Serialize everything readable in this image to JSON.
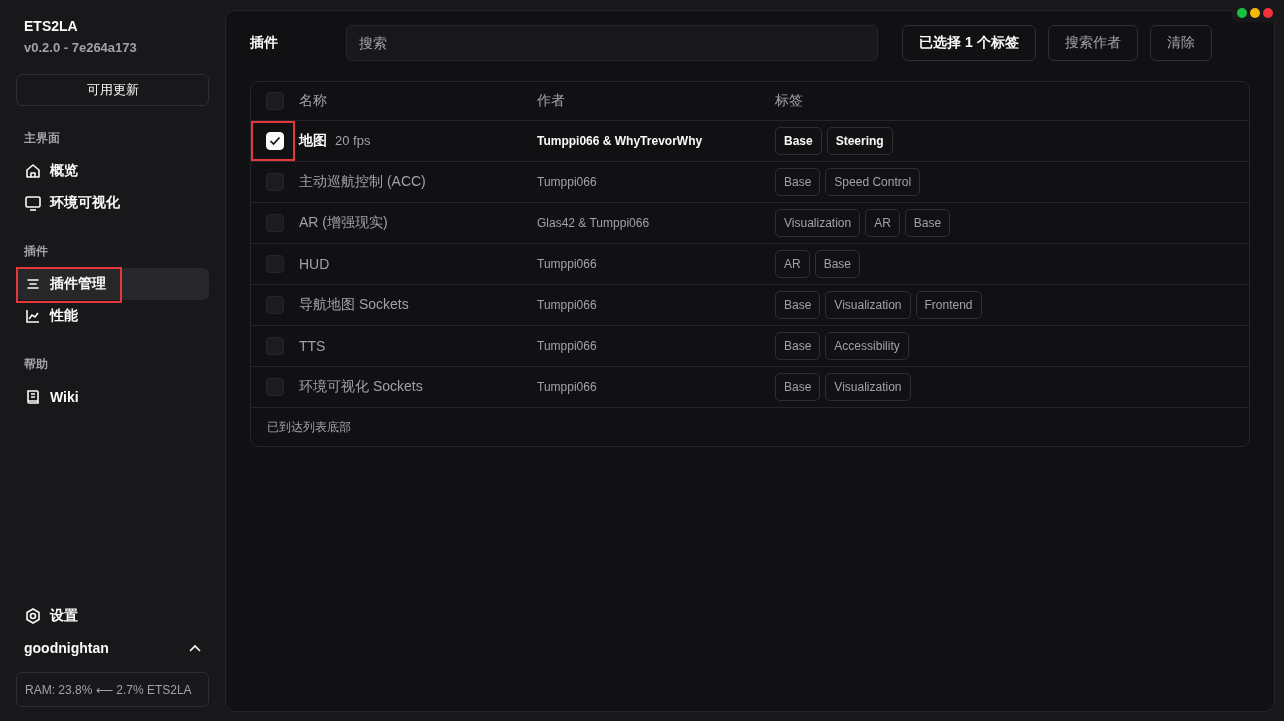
{
  "app": {
    "name": "ETS2LA",
    "version": "v0.2.0 - 7e264a173",
    "update_button": "可用更新"
  },
  "sidebar": {
    "sections": [
      {
        "title": "主界面",
        "items": [
          {
            "label": "概览",
            "selected": false,
            "highlighted": false
          },
          {
            "label": "环境可视化",
            "selected": false,
            "highlighted": false
          }
        ]
      },
      {
        "title": "插件",
        "items": [
          {
            "label": "插件管理",
            "selected": true,
            "highlighted": true
          },
          {
            "label": "性能",
            "selected": false,
            "highlighted": false
          }
        ]
      },
      {
        "title": "帮助",
        "items": [
          {
            "label": "Wiki",
            "selected": false,
            "highlighted": false
          }
        ]
      }
    ],
    "settings": "设置",
    "user": "goodnightan",
    "status": "RAM: 23.8% ⟵ 2.7% ETS2LA"
  },
  "header": {
    "title": "插件",
    "search": {
      "placeholder": "搜索"
    },
    "buttons": [
      {
        "label": "已选择 1 个标签",
        "active": true
      },
      {
        "label": "搜索作者",
        "active": false
      },
      {
        "label": "清除",
        "active": false
      }
    ]
  },
  "table": {
    "columns": [
      "名称",
      "作者",
      "标签"
    ],
    "all_checked": false,
    "rows": [
      {
        "name": "地图",
        "fps": "20 fps",
        "author": "Tumppi066 & WhyTrevorWhy",
        "tags": [
          "Base",
          "Steering"
        ],
        "checked": true,
        "highlighted": true
      },
      {
        "name": "主动巡航控制 (ACC)",
        "author": "Tumppi066",
        "tags": [
          "Base",
          "Speed Control"
        ],
        "checked": false,
        "highlighted": false
      },
      {
        "name": "AR (增强现实)",
        "author": "Glas42 & Tumppi066",
        "tags": [
          "Visualization",
          "AR",
          "Base"
        ],
        "checked": false,
        "highlighted": false
      },
      {
        "name": "HUD",
        "author": "Tumppi066",
        "tags": [
          "AR",
          "Base"
        ],
        "checked": false,
        "highlighted": false
      },
      {
        "name": "导航地图 Sockets",
        "author": "Tumppi066",
        "tags": [
          "Base",
          "Visualization",
          "Frontend"
        ],
        "checked": false,
        "highlighted": false
      },
      {
        "name": "TTS",
        "author": "Tumppi066",
        "tags": [
          "Base",
          "Accessibility"
        ],
        "checked": false,
        "highlighted": false
      },
      {
        "name": "环境可视化 Sockets",
        "author": "Tumppi066",
        "tags": [
          "Base",
          "Visualization"
        ],
        "checked": false,
        "highlighted": false
      }
    ],
    "footer": "已到达列表底部"
  }
}
